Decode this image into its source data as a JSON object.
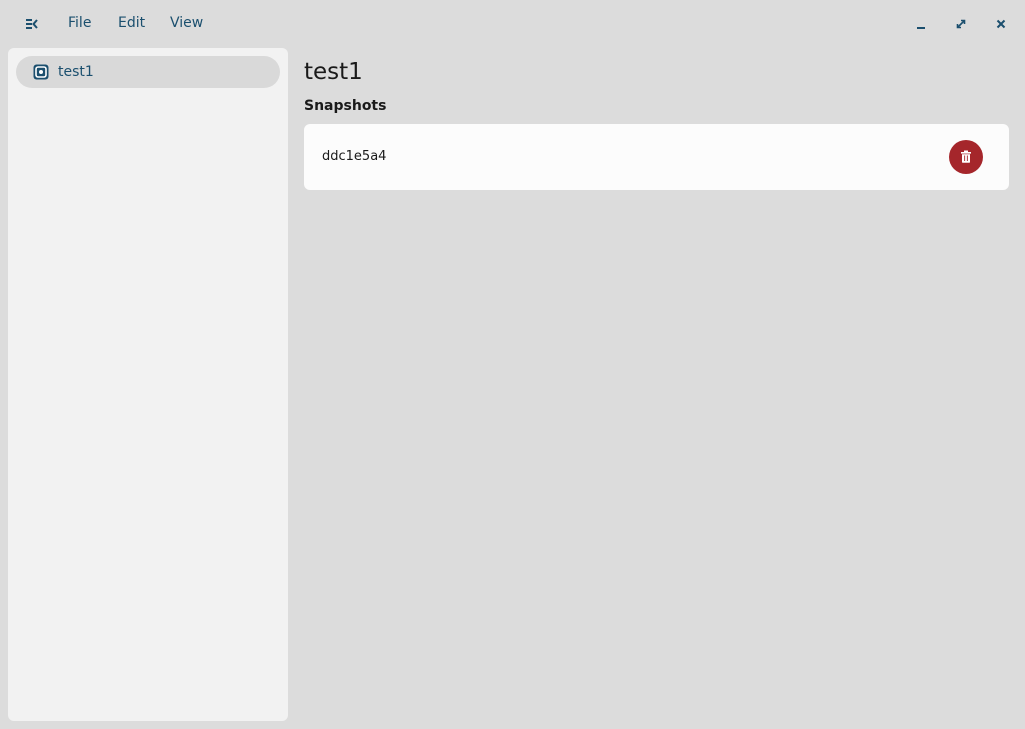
{
  "header": {
    "menu_toggle_icon": "sidebar-toggle-icon",
    "menu": [
      {
        "label": "File"
      },
      {
        "label": "Edit"
      },
      {
        "label": "View"
      }
    ],
    "window_controls": [
      "minimize-icon",
      "maximize-icon",
      "close-icon"
    ]
  },
  "sidebar": {
    "items": [
      {
        "label": "test1",
        "icon": "disk-icon",
        "selected": true
      }
    ]
  },
  "main": {
    "title": "test1",
    "section_title": "Snapshots",
    "snapshots": [
      {
        "name": "ddc1e5a4",
        "action_icon": "trash-icon"
      }
    ]
  },
  "colors": {
    "accent": "#1b4f6e",
    "danger": "#a5262b",
    "window_bg": "#dcdcdc",
    "sidebar_bg": "#f2f2f2",
    "card_bg": "#fcfcfc",
    "selected_bg": "#d9d9d9"
  }
}
